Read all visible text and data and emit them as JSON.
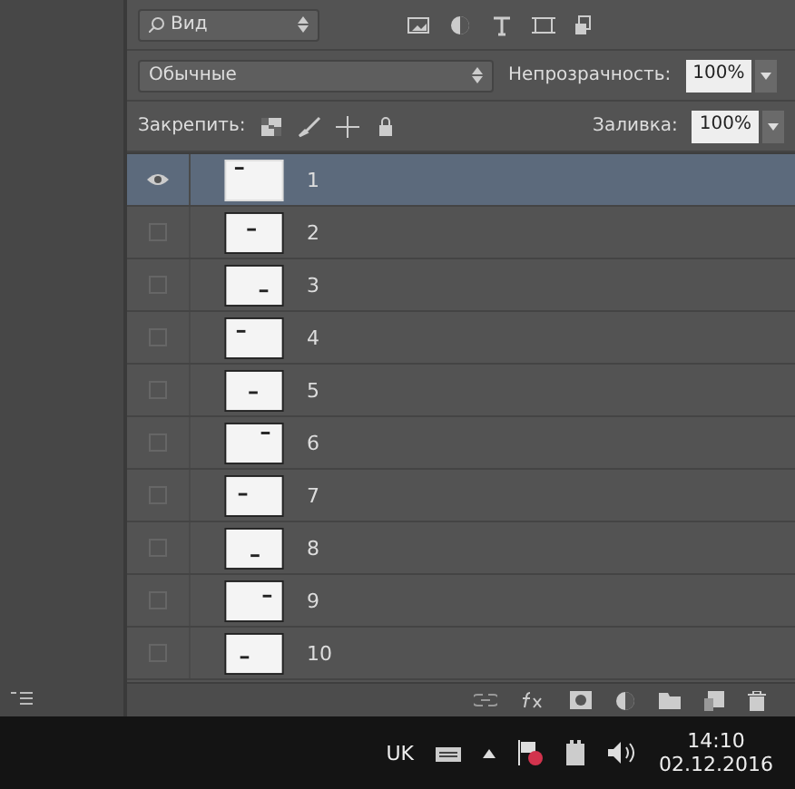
{
  "filter": {
    "label": "Вид"
  },
  "blend_mode": {
    "value": "Обычные"
  },
  "opacity": {
    "label": "Непрозрачность:",
    "value": "100%"
  },
  "lock": {
    "label": "Закрепить:"
  },
  "fill": {
    "label": "Заливка:",
    "value": "100%"
  },
  "layers": [
    {
      "name": "1",
      "visible": true,
      "selected": true
    },
    {
      "name": "2",
      "visible": false,
      "selected": false
    },
    {
      "name": "3",
      "visible": false,
      "selected": false
    },
    {
      "name": "4",
      "visible": false,
      "selected": false
    },
    {
      "name": "5",
      "visible": false,
      "selected": false
    },
    {
      "name": "6",
      "visible": false,
      "selected": false
    },
    {
      "name": "7",
      "visible": false,
      "selected": false
    },
    {
      "name": "8",
      "visible": false,
      "selected": false
    },
    {
      "name": "9",
      "visible": false,
      "selected": false
    },
    {
      "name": "10",
      "visible": false,
      "selected": false
    }
  ],
  "taskbar": {
    "language": "UK",
    "time": "14:10",
    "date": "02.12.2016"
  }
}
